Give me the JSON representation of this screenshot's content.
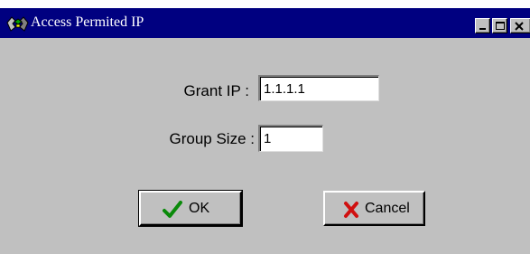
{
  "window": {
    "title": "Access Permited IP",
    "app_icon": "network-icon",
    "controls": {
      "minimize": "minimize-icon",
      "maximize": "maximize-icon",
      "close": "close-icon"
    }
  },
  "form": {
    "grant_ip": {
      "label": "Grant IP :",
      "value": "1.1.1.1"
    },
    "group_size": {
      "label": "Group Size :",
      "value": "1"
    }
  },
  "buttons": {
    "ok": {
      "label": "OK",
      "icon": "checkmark-icon"
    },
    "cancel": {
      "label": "Cancel",
      "icon": "x-mark-icon"
    }
  },
  "colors": {
    "titlebar": "#000080",
    "face": "#c0c0c0",
    "check": "#0a8a0a",
    "cross": "#d01010"
  }
}
